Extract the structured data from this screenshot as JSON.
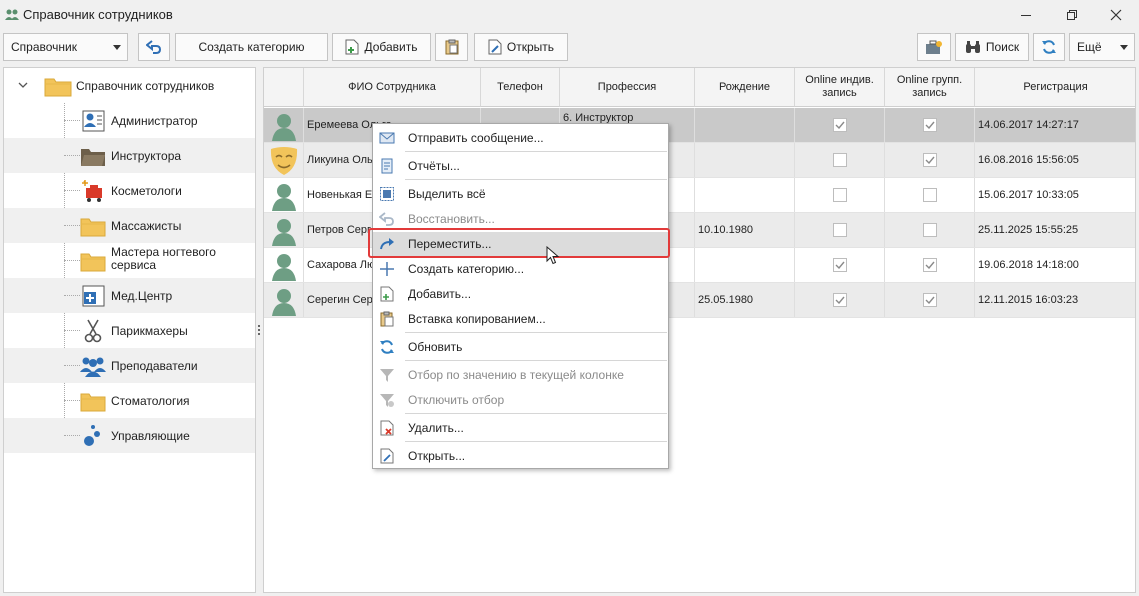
{
  "window": {
    "title": "Справочник сотрудников",
    "minimize_icon": "minimize-icon",
    "restore_icon": "restore-icon",
    "close_icon": "close-icon"
  },
  "toolbar": {
    "mode_select": "Справочник",
    "create_category": "Создать категорию",
    "add": "Добавить",
    "open": "Открыть",
    "search": "Поиск",
    "more": "Ещё"
  },
  "tree": {
    "root": "Справочник сотрудников",
    "items": [
      {
        "label": "Администратор",
        "icon": "admin-card-icon"
      },
      {
        "label": "Инструктора",
        "icon": "folder-dark-icon"
      },
      {
        "label": "Косметологи",
        "icon": "cosmetology-icon"
      },
      {
        "label": "Массажисты",
        "icon": "folder-icon"
      },
      {
        "label": "Мастера ногтевого сервиса",
        "icon": "folder-icon"
      },
      {
        "label": "Мед.Центр",
        "icon": "medical-icon"
      },
      {
        "label": "Парикмахеры",
        "icon": "scissors-icon"
      },
      {
        "label": "Преподаватели",
        "icon": "people-icon"
      },
      {
        "label": "Стоматология",
        "icon": "folder-icon"
      },
      {
        "label": "Управляющие",
        "icon": "bubbles-icon"
      }
    ]
  },
  "grid": {
    "columns": [
      "ФИО Сотрудника",
      "Телефон",
      "Профессия",
      "Рождение",
      "Online индив. запись",
      "Online групп. запись",
      "Регистрация"
    ],
    "rows": [
      {
        "name": "Еремеева Ольга",
        "phone": "",
        "profession": "6. Инструктор",
        "birth": "",
        "indiv": true,
        "group": true,
        "reg": "14.06.2017 14:27:17",
        "avatar": "person-icon"
      },
      {
        "name": "Ликуина Оль",
        "phone": "",
        "profession": "",
        "birth": "",
        "indiv": false,
        "group": true,
        "reg": "16.08.2016 15:56:05",
        "avatar": "mask-icon"
      },
      {
        "name": "Новенькая Ел",
        "phone": "",
        "profession": "",
        "birth": "",
        "indiv": false,
        "group": false,
        "reg": "15.06.2017 10:33:05",
        "avatar": "person-icon"
      },
      {
        "name": "Петров Серг",
        "phone": "",
        "profession": "",
        "birth": "10.10.1980",
        "indiv": false,
        "group": false,
        "reg": "25.11.2025 15:55:25",
        "avatar": "person-icon"
      },
      {
        "name": "Сахарова Лю",
        "phone": "",
        "profession": "",
        "birth": "",
        "indiv": true,
        "group": true,
        "reg": "19.06.2018 14:18:00",
        "avatar": "person-icon"
      },
      {
        "name": "Серегин Серг",
        "phone": "",
        "profession": "",
        "birth": "25.05.1980",
        "indiv": true,
        "group": true,
        "reg": "12.11.2015 16:03:23",
        "avatar": "person-icon"
      }
    ]
  },
  "context_menu": {
    "items": [
      {
        "label": "Отправить сообщение...",
        "icon": "message-icon",
        "disabled": false
      },
      {
        "label": "Отчёты...",
        "icon": "report-icon",
        "disabled": false
      },
      {
        "label": "Выделить всё",
        "icon": "select-all-icon",
        "disabled": false
      },
      {
        "label": "Восстановить...",
        "icon": "undo-icon",
        "disabled": true
      },
      {
        "label": "Переместить...",
        "icon": "move-arrow-icon",
        "disabled": false
      },
      {
        "label": "Создать категорию...",
        "icon": "plus-icon",
        "disabled": false
      },
      {
        "label": "Добавить...",
        "icon": "add-doc-icon",
        "disabled": false
      },
      {
        "label": "Вставка копированием...",
        "icon": "paste-icon",
        "disabled": false
      },
      {
        "label": "Обновить",
        "icon": "refresh-icon",
        "disabled": false
      },
      {
        "label": "Отбор по значению в текущей колонке",
        "icon": "filter-icon",
        "disabled": true
      },
      {
        "label": "Отключить отбор",
        "icon": "filter-off-icon",
        "disabled": true
      },
      {
        "label": "Удалить...",
        "icon": "delete-doc-icon",
        "disabled": false
      },
      {
        "label": "Открыть...",
        "icon": "open-doc-icon",
        "disabled": false
      }
    ],
    "highlighted": "Переместить..."
  },
  "colors": {
    "highlight_border": "#e23a3a",
    "selected_row": "#c9c9c9",
    "accent_blue": "#2f7fc1",
    "avatar_green": "#6e9e84",
    "folder_yellow": "#f2c45a"
  }
}
